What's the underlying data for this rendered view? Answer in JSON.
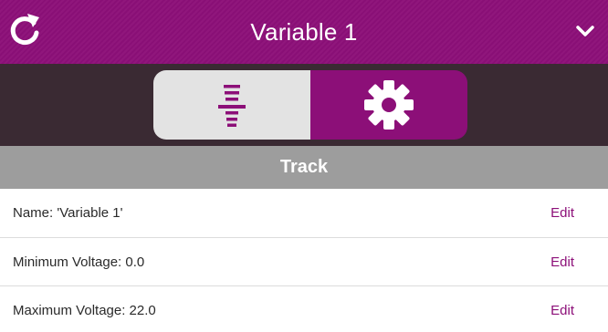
{
  "header": {
    "title": "Variable 1",
    "refresh_icon": "refresh-icon",
    "menu_icon": "chevron-down-icon"
  },
  "toolbar": {
    "tabs": [
      {
        "icon": "signal-tower-icon",
        "selected": false
      },
      {
        "icon": "gear-icon",
        "selected": true
      }
    ]
  },
  "section": {
    "title": "Track"
  },
  "rows": [
    {
      "label": "Name: 'Variable 1'",
      "action": "Edit"
    },
    {
      "label": "Minimum Voltage: 0.0",
      "action": "Edit"
    },
    {
      "label": "Maximum Voltage: 22.0",
      "action": "Edit"
    }
  ],
  "colors": {
    "brand": "#8c0f78",
    "toolbar_bg": "#3a2a33",
    "section_bg": "#9d9d9d",
    "segment_off": "#e3e3e3"
  }
}
